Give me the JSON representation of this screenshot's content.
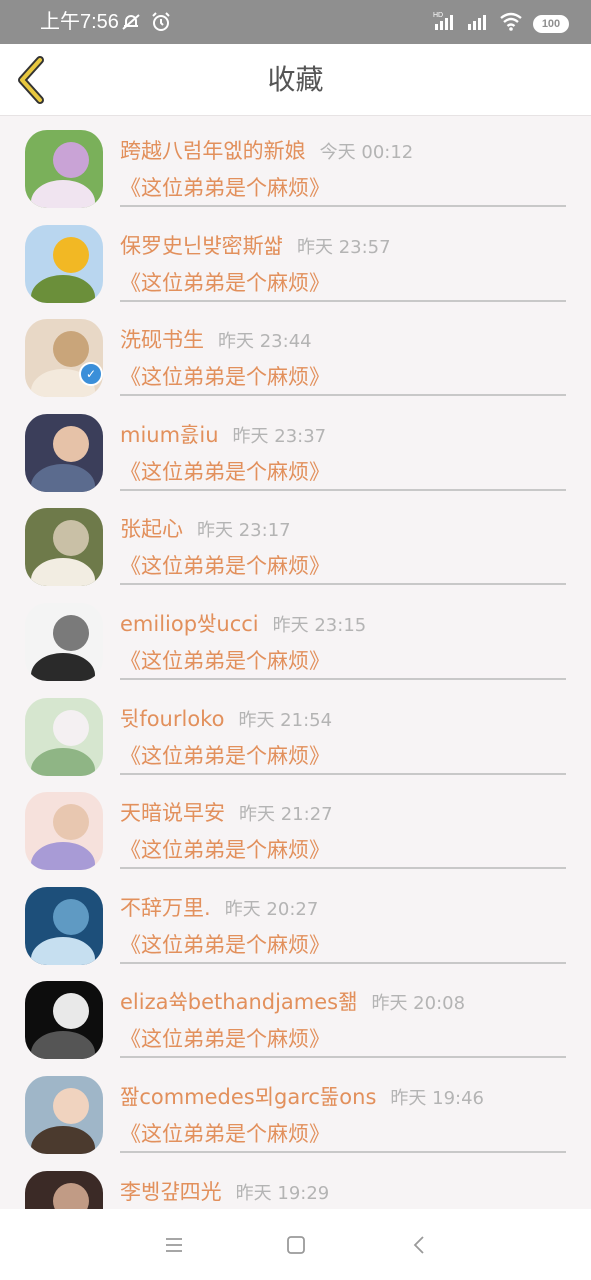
{
  "status_bar": {
    "time": "上午7:56",
    "battery": "100",
    "icons": [
      "notifications-off-icon",
      "alarm-icon",
      "hd-signal-icon",
      "signal-icon",
      "wifi-icon",
      "battery-icon"
    ]
  },
  "header": {
    "title": "收藏",
    "back_icon": "chevron-left-icon",
    "accent": "#e8c840"
  },
  "colors": {
    "name": "#e2905c",
    "time": "#b4b4b4",
    "divider": "#c8c8c8",
    "background": "#f7f4f5"
  },
  "items": [
    {
      "name": "跨越八럼年엢的新娘",
      "time": "今天 00:12",
      "book": "《这位弟弟是个麻烦》",
      "avatar": "flower-photo"
    },
    {
      "name": "保罗史닌뱢密斯쌻",
      "time": "昨天 23:57",
      "book": "《这位弟弟是个麻烦》",
      "avatar": "sunflower-photo"
    },
    {
      "name": "洗砚书生",
      "time": "昨天 23:44",
      "book": "《这位弟弟是个麻烦》",
      "avatar": "portrait-photo",
      "verified": true
    },
    {
      "name": "mium흜iu",
      "time": "昨天 23:37",
      "book": "《这位弟弟是个麻烦》",
      "avatar": "child-photo"
    },
    {
      "name": "张起心",
      "time": "昨天 23:17",
      "book": "《这位弟弟是个麻烦》",
      "avatar": "field-photo"
    },
    {
      "name": "emiliop쌎ucci",
      "time": "昨天 23:15",
      "book": "《这位弟弟是个麻烦》",
      "avatar": "bw-portrait-photo"
    },
    {
      "name": "뒷fourloko",
      "time": "昨天 21:54",
      "book": "《这位弟弟是个麻烦》",
      "avatar": "girl-garden-photo"
    },
    {
      "name": "天暗说早安",
      "time": "昨天 21:27",
      "book": "《这位弟弟是个麻烦》",
      "avatar": "anime-photo"
    },
    {
      "name": "不辞万里.",
      "time": "昨天 20:27",
      "book": "《这位弟弟是个麻烦》",
      "avatar": "ocean-photo"
    },
    {
      "name": "eliza쓕bethandjames좲",
      "time": "昨天 20:08",
      "book": "《这位弟弟是个麻烦》",
      "avatar": "mask-photo"
    },
    {
      "name": "짪commedes뫼garc뚪ons",
      "time": "昨天 19:46",
      "book": "《这位弟弟是个麻烦》",
      "avatar": "kid-photo"
    },
    {
      "name": "李벵걒四光",
      "time": "昨天 19:29",
      "book": "",
      "avatar": "dark-portrait-photo"
    }
  ],
  "nav": {
    "icons": [
      "menu-icon",
      "home-icon",
      "back-icon"
    ]
  }
}
